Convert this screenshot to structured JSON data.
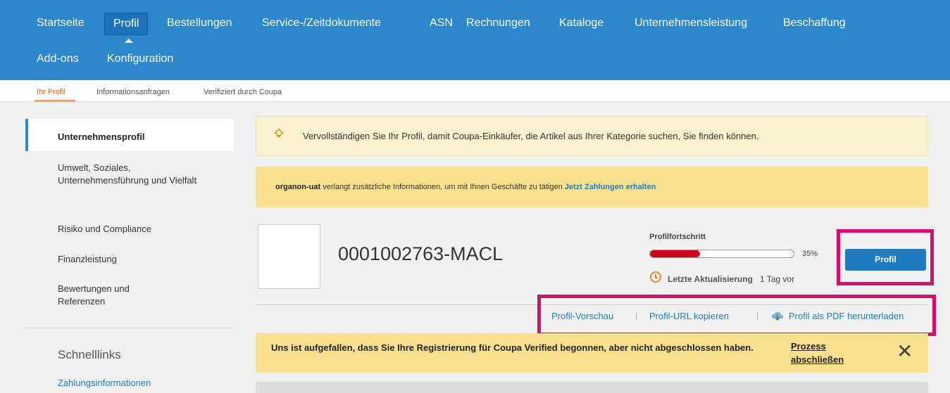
{
  "nav": {
    "row1": [
      "Startseite",
      "Profil",
      "Bestellungen",
      "Service-/Zeitdokumente",
      "ASN",
      "Rechnungen",
      "Kataloge",
      "Unternehmensleistung",
      "Beschaffung"
    ],
    "row2": [
      "Add-ons",
      "Konfiguration"
    ],
    "active": "Profil"
  },
  "subnav": {
    "items": [
      "Ihr Profil",
      "Informationsanfragen",
      "Verifiziert durch Coupa"
    ],
    "active": "Ihr Profil"
  },
  "sidebar": {
    "items": [
      "Unternehmensprofil",
      "Umwelt, Soziales, Unternehmensführung und Vielfalt",
      "Risiko und Compliance",
      "Finanzleistung",
      "Bewertungen und Referenzen"
    ],
    "quicklinks_title": "Schnelllinks",
    "quicklinks": [
      "Zahlungsinformationen"
    ]
  },
  "tip": {
    "icon": "lightbulb-icon",
    "text": "Vervollständigen Sie Ihr Profil, damit Coupa-Einkäufer, die Artikel aus Ihrer Kategorie suchen, Sie finden können."
  },
  "request": {
    "customer": "organon-uat",
    "text": " verlangt zusätzliche Informationen, um mit Ihnen Geschäfte zu tätigen ",
    "link": "Jetzt Zahlungen erhalten"
  },
  "profile": {
    "company": "0001002763-MACL",
    "progress_label": "Profilfortschritt",
    "progress_pct": 35,
    "progress_text": "35%",
    "updated_label": "Letzte Aktualisierung",
    "updated_value": "1 Tag vor",
    "button": "Profil"
  },
  "links": {
    "preview": "Profil-Vorschau",
    "copy_url": "Profil-URL kopieren",
    "pdf": "Profil als PDF herunterladen",
    "separator": "|"
  },
  "verified": {
    "text": "Uns ist aufgefallen, dass Sie Ihre Registrierung für Coupa Verified begonnen, aber nicht abgeschlossen haben.",
    "link": "Prozess abschließen",
    "close": "✕"
  },
  "colors": {
    "nav_bg": "#2c88cb",
    "accent": "#1b7fc2",
    "highlight": "#d4106f",
    "progress": "#d0021b"
  }
}
